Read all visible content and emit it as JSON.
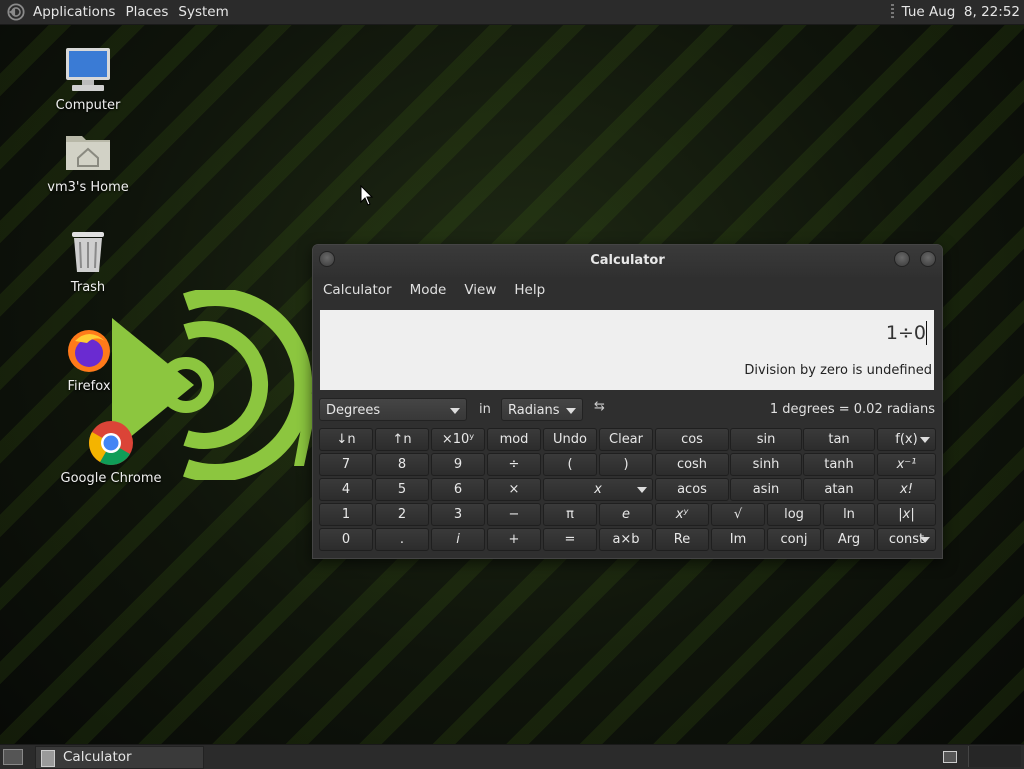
{
  "top_panel": {
    "menus": [
      "Applications",
      "Places",
      "System"
    ],
    "clock": "Tue Aug  8, 22:52"
  },
  "desktop": {
    "icons": [
      {
        "label": "Computer",
        "icon": "computer-icon"
      },
      {
        "label": "vm3's Home",
        "icon": "home-folder-icon"
      },
      {
        "label": "Trash",
        "icon": "trash-icon"
      },
      {
        "label": "Firefox",
        "icon": "firefox-icon"
      },
      {
        "label": "Google Chrome",
        "icon": "chrome-icon"
      }
    ]
  },
  "calculator": {
    "title": "Calculator",
    "menus": [
      "Calculator",
      "Mode",
      "View",
      "Help"
    ],
    "display": {
      "expression": "1÷0",
      "status": "Division by zero is undefined"
    },
    "conversion": {
      "from_unit": "Degrees",
      "in_label": "in",
      "to_unit": "Radians",
      "swap_symbol": "⇆",
      "result": "1 degrees = 0.02 radians"
    },
    "keypad": {
      "rows": [
        [
          "↓n",
          "↑n",
          "×10ʸ",
          "mod",
          "Undo",
          "Clear",
          "cos",
          "sin",
          "tan",
          "f(x)"
        ],
        [
          "7",
          "8",
          "9",
          "÷",
          "(",
          ")",
          "cosh",
          "sinh",
          "tanh",
          "x⁻¹"
        ],
        [
          "4",
          "5",
          "6",
          "×",
          "x",
          "acos",
          "asin",
          "atan",
          "x!"
        ],
        [
          "1",
          "2",
          "3",
          "−",
          "π",
          "e",
          "xʸ",
          "√",
          "log",
          "ln",
          "|x|"
        ],
        [
          "0",
          ".",
          "i",
          "+",
          "=",
          "a×b",
          "Re",
          "Im",
          "conj",
          "Arg",
          "const"
        ]
      ]
    }
  },
  "taskbar": {
    "tasks": [
      "Calculator"
    ]
  },
  "colors": {
    "panel": "#2b2b2b",
    "window_bg": "#2f2f2f",
    "display_bg": "#efefef",
    "accent_green": "#8cc63f"
  }
}
